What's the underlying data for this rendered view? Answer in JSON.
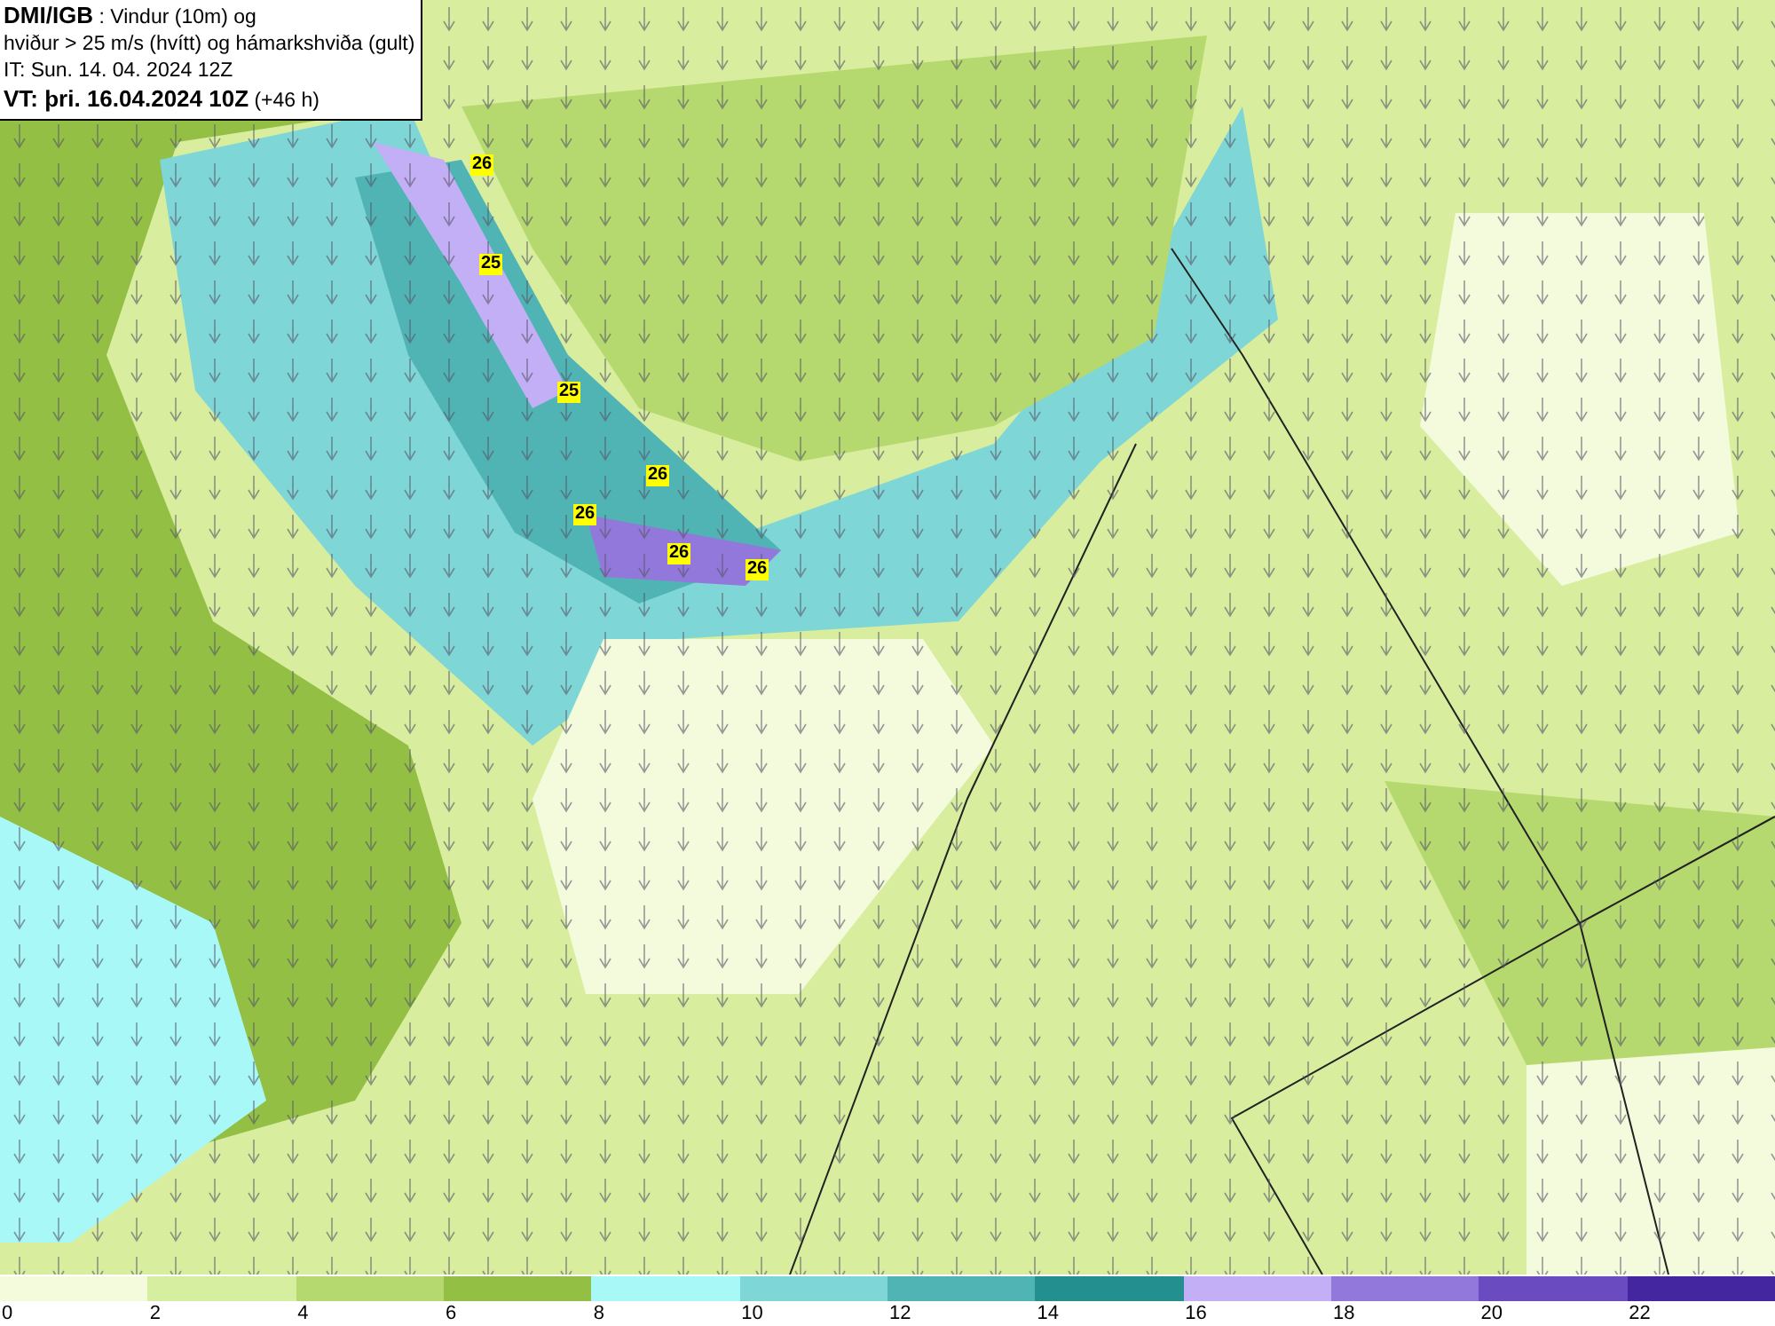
{
  "info_box": {
    "lines": [
      "**DMI/IGB** : Vindur (10m) og",
      "hviður > 25 m/s (hvítt) og hámarkshviða (gult)",
      "IT: Sun. 14. 04. 2024 12Z",
      "**VT: þri. 16.04.2024 10Z** (+46 h)"
    ]
  },
  "map": {
    "gust_labels": [
      "26",
      "25",
      "25",
      "26",
      "26",
      "26",
      "26"
    ]
  },
  "legend": {
    "bins": [
      {
        "color": "#f3fbdc"
      },
      {
        "color": "#d6eea0"
      },
      {
        "color": "#b5d96e"
      },
      {
        "color": "#93bf45"
      },
      {
        "color": "#a8f8f8"
      },
      {
        "color": "#7fd6d6"
      },
      {
        "color": "#50b4b4"
      },
      {
        "color": "#238f8f"
      },
      {
        "color": "#c3aff5"
      },
      {
        "color": "#9378db"
      },
      {
        "color": "#6a4cc0"
      },
      {
        "color": "#4326a0"
      }
    ],
    "ticks": [
      "0",
      "2",
      "4",
      "6",
      "8",
      "10",
      "12",
      "14",
      "16",
      "18",
      "20",
      "22"
    ]
  }
}
